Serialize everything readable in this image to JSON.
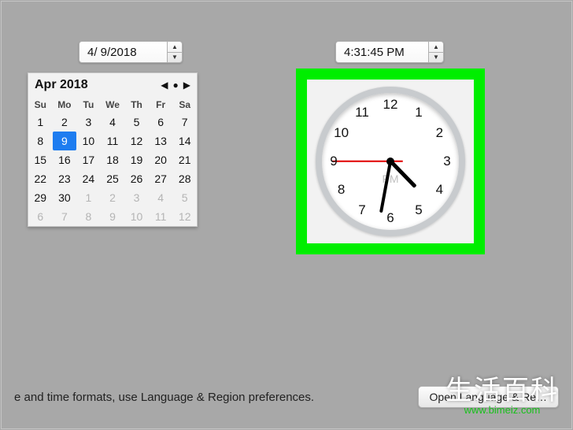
{
  "date": {
    "value": "4/ 9/2018"
  },
  "time": {
    "value": "4:31:45 PM"
  },
  "calendar": {
    "month_label": "Apr 2018",
    "weekdays": [
      "Su",
      "Mo",
      "Tu",
      "We",
      "Th",
      "Fr",
      "Sa"
    ],
    "cells": [
      {
        "n": 1,
        "dim": false,
        "sel": false
      },
      {
        "n": 2,
        "dim": false,
        "sel": false
      },
      {
        "n": 3,
        "dim": false,
        "sel": false
      },
      {
        "n": 4,
        "dim": false,
        "sel": false
      },
      {
        "n": 5,
        "dim": false,
        "sel": false
      },
      {
        "n": 6,
        "dim": false,
        "sel": false
      },
      {
        "n": 7,
        "dim": false,
        "sel": false
      },
      {
        "n": 8,
        "dim": false,
        "sel": false
      },
      {
        "n": 9,
        "dim": false,
        "sel": true
      },
      {
        "n": 10,
        "dim": false,
        "sel": false
      },
      {
        "n": 11,
        "dim": false,
        "sel": false
      },
      {
        "n": 12,
        "dim": false,
        "sel": false
      },
      {
        "n": 13,
        "dim": false,
        "sel": false
      },
      {
        "n": 14,
        "dim": false,
        "sel": false
      },
      {
        "n": 15,
        "dim": false,
        "sel": false
      },
      {
        "n": 16,
        "dim": false,
        "sel": false
      },
      {
        "n": 17,
        "dim": false,
        "sel": false
      },
      {
        "n": 18,
        "dim": false,
        "sel": false
      },
      {
        "n": 19,
        "dim": false,
        "sel": false
      },
      {
        "n": 20,
        "dim": false,
        "sel": false
      },
      {
        "n": 21,
        "dim": false,
        "sel": false
      },
      {
        "n": 22,
        "dim": false,
        "sel": false
      },
      {
        "n": 23,
        "dim": false,
        "sel": false
      },
      {
        "n": 24,
        "dim": false,
        "sel": false
      },
      {
        "n": 25,
        "dim": false,
        "sel": false
      },
      {
        "n": 26,
        "dim": false,
        "sel": false
      },
      {
        "n": 27,
        "dim": false,
        "sel": false
      },
      {
        "n": 28,
        "dim": false,
        "sel": false
      },
      {
        "n": 29,
        "dim": false,
        "sel": false
      },
      {
        "n": 30,
        "dim": false,
        "sel": false
      },
      {
        "n": 1,
        "dim": true,
        "sel": false
      },
      {
        "n": 2,
        "dim": true,
        "sel": false
      },
      {
        "n": 3,
        "dim": true,
        "sel": false
      },
      {
        "n": 4,
        "dim": true,
        "sel": false
      },
      {
        "n": 5,
        "dim": true,
        "sel": false
      },
      {
        "n": 6,
        "dim": true,
        "sel": false
      },
      {
        "n": 7,
        "dim": true,
        "sel": false
      },
      {
        "n": 8,
        "dim": true,
        "sel": false
      },
      {
        "n": 9,
        "dim": true,
        "sel": false
      },
      {
        "n": 10,
        "dim": true,
        "sel": false
      },
      {
        "n": 11,
        "dim": true,
        "sel": false
      },
      {
        "n": 12,
        "dim": true,
        "sel": false
      }
    ]
  },
  "clock": {
    "numbers": [
      "12",
      "1",
      "2",
      "3",
      "4",
      "5",
      "6",
      "7",
      "8",
      "9",
      "10",
      "11"
    ],
    "ampm": "PM",
    "hour_angle": 135.8,
    "minute_angle": 190.5,
    "second_angle": 270
  },
  "bottom": {
    "hint": "e and time formats, use Language & Region preferences.",
    "button": "Open Language & Re…"
  },
  "watermark": {
    "line1": "生活百科",
    "line2": "www.bimeiz.com"
  }
}
